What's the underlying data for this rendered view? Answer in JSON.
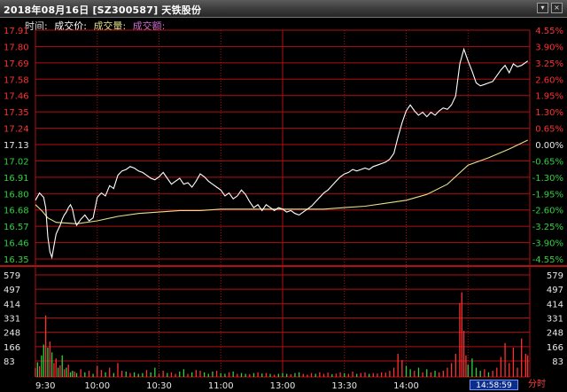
{
  "window": {
    "title": "2018年08月16日 [SZ300587] 天铁股份",
    "buttons": [
      "▾",
      "×"
    ]
  },
  "legend": {
    "items": [
      "时间",
      "成交价",
      "成交量",
      "成交额"
    ],
    "separator": ":"
  },
  "colors": {
    "grid": "#b01010",
    "price_line": "#ffffff",
    "avg_line": "#e6e08c",
    "volume_up": "#ff3030",
    "volume_down": "#30d040",
    "axis_up": "#ff3030",
    "axis_flat": "#e8e8e8",
    "axis_down": "#30d040",
    "volume_axis": "#e8e8e8"
  },
  "status": {
    "current_time": "14:58:59",
    "mode": "分时"
  },
  "chart_data": {
    "type": "line",
    "price_axis_left": [
      "17.91",
      "17.80",
      "17.69",
      "17.58",
      "17.46",
      "17.35",
      "17.24",
      "17.13",
      "17.02",
      "16.91",
      "16.80",
      "16.68",
      "16.57",
      "16.46",
      "16.35"
    ],
    "price_axis_right": [
      "4.55%",
      "3.90%",
      "3.25%",
      "2.60%",
      "1.95%",
      "1.30%",
      "0.65%",
      "0.00%",
      "-0.65%",
      "-1.30%",
      "-1.95%",
      "-2.60%",
      "-3.25%",
      "-3.90%",
      "-4.55%"
    ],
    "volume_axis": [
      "579",
      "497",
      "414",
      "331",
      "248",
      "166",
      "83"
    ],
    "x_labels": [
      "9:30",
      "10:00",
      "10:30",
      "11:00",
      "13:00",
      "13:30",
      "14:00"
    ],
    "price_range": [
      16.35,
      17.91
    ],
    "volume_range": [
      0,
      663
    ],
    "minutes_total": 240,
    "series": [
      {
        "values": [
          [
            0,
            16.75
          ],
          [
            2,
            16.8
          ],
          [
            4,
            16.77
          ],
          [
            5,
            16.7
          ],
          [
            6,
            16.5
          ],
          [
            7,
            16.4
          ],
          [
            8,
            16.36
          ],
          [
            9,
            16.44
          ],
          [
            10,
            16.52
          ],
          [
            11,
            16.55
          ],
          [
            12,
            16.58
          ],
          [
            13,
            16.62
          ],
          [
            14,
            16.65
          ],
          [
            15,
            16.67
          ],
          [
            16,
            16.7
          ],
          [
            17,
            16.72
          ],
          [
            18,
            16.69
          ],
          [
            19,
            16.62
          ],
          [
            20,
            16.58
          ],
          [
            22,
            16.62
          ],
          [
            24,
            16.65
          ],
          [
            26,
            16.61
          ],
          [
            28,
            16.63
          ],
          [
            30,
            16.77
          ],
          [
            32,
            16.8
          ],
          [
            34,
            16.78
          ],
          [
            36,
            16.85
          ],
          [
            38,
            16.83
          ],
          [
            40,
            16.92
          ],
          [
            42,
            16.95
          ],
          [
            44,
            16.96
          ],
          [
            46,
            16.98
          ],
          [
            48,
            16.97
          ],
          [
            50,
            16.95
          ],
          [
            52,
            16.94
          ],
          [
            54,
            16.92
          ],
          [
            56,
            16.9
          ],
          [
            58,
            16.89
          ],
          [
            60,
            16.91
          ],
          [
            62,
            16.94
          ],
          [
            64,
            16.9
          ],
          [
            66,
            16.86
          ],
          [
            68,
            16.88
          ],
          [
            70,
            16.9
          ],
          [
            72,
            16.86
          ],
          [
            74,
            16.87
          ],
          [
            76,
            16.84
          ],
          [
            78,
            16.88
          ],
          [
            80,
            16.93
          ],
          [
            82,
            16.91
          ],
          [
            84,
            16.88
          ],
          [
            86,
            16.86
          ],
          [
            88,
            16.84
          ],
          [
            90,
            16.82
          ],
          [
            92,
            16.78
          ],
          [
            94,
            16.8
          ],
          [
            96,
            16.76
          ],
          [
            98,
            16.78
          ],
          [
            100,
            16.82
          ],
          [
            102,
            16.79
          ],
          [
            104,
            16.74
          ],
          [
            106,
            16.7
          ],
          [
            108,
            16.72
          ],
          [
            110,
            16.68
          ],
          [
            112,
            16.72
          ],
          [
            114,
            16.7
          ],
          [
            116,
            16.68
          ],
          [
            118,
            16.7
          ],
          [
            120,
            16.69
          ],
          [
            122,
            16.67
          ],
          [
            124,
            16.68
          ],
          [
            126,
            16.66
          ],
          [
            128,
            16.65
          ],
          [
            130,
            16.67
          ],
          [
            132,
            16.69
          ],
          [
            134,
            16.71
          ],
          [
            136,
            16.74
          ],
          [
            138,
            16.77
          ],
          [
            140,
            16.8
          ],
          [
            142,
            16.82
          ],
          [
            144,
            16.85
          ],
          [
            146,
            16.88
          ],
          [
            148,
            16.91
          ],
          [
            150,
            16.93
          ],
          [
            152,
            16.94
          ],
          [
            154,
            16.96
          ],
          [
            156,
            16.95
          ],
          [
            158,
            16.96
          ],
          [
            160,
            16.97
          ],
          [
            162,
            16.96
          ],
          [
            164,
            16.98
          ],
          [
            166,
            16.99
          ],
          [
            168,
            17.0
          ],
          [
            170,
            17.01
          ],
          [
            172,
            17.03
          ],
          [
            174,
            17.07
          ],
          [
            176,
            17.18
          ],
          [
            178,
            17.28
          ],
          [
            180,
            17.36
          ],
          [
            182,
            17.4
          ],
          [
            184,
            17.36
          ],
          [
            186,
            17.33
          ],
          [
            188,
            17.35
          ],
          [
            190,
            17.32
          ],
          [
            192,
            17.35
          ],
          [
            194,
            17.33
          ],
          [
            196,
            17.36
          ],
          [
            198,
            17.38
          ],
          [
            200,
            17.37
          ],
          [
            202,
            17.4
          ],
          [
            204,
            17.46
          ],
          [
            206,
            17.68
          ],
          [
            208,
            17.78
          ],
          [
            210,
            17.7
          ],
          [
            212,
            17.63
          ],
          [
            214,
            17.55
          ],
          [
            216,
            17.53
          ],
          [
            218,
            17.54
          ],
          [
            220,
            17.55
          ],
          [
            222,
            17.56
          ],
          [
            224,
            17.6
          ],
          [
            226,
            17.64
          ],
          [
            228,
            17.67
          ],
          [
            230,
            17.62
          ],
          [
            232,
            17.68
          ],
          [
            234,
            17.66
          ],
          [
            236,
            17.67
          ],
          [
            238,
            17.69
          ],
          [
            239,
            17.7
          ]
        ]
      },
      {
        "values": [
          [
            0,
            16.72
          ],
          [
            3,
            16.68
          ],
          [
            6,
            16.63
          ],
          [
            10,
            16.6
          ],
          [
            20,
            16.59
          ],
          [
            30,
            16.61
          ],
          [
            40,
            16.64
          ],
          [
            50,
            16.66
          ],
          [
            60,
            16.67
          ],
          [
            70,
            16.68
          ],
          [
            80,
            16.68
          ],
          [
            90,
            16.69
          ],
          [
            100,
            16.69
          ],
          [
            110,
            16.69
          ],
          [
            120,
            16.69
          ],
          [
            130,
            16.69
          ],
          [
            140,
            16.69
          ],
          [
            150,
            16.7
          ],
          [
            160,
            16.71
          ],
          [
            170,
            16.73
          ],
          [
            180,
            16.75
          ],
          [
            190,
            16.79
          ],
          [
            200,
            16.86
          ],
          [
            210,
            16.99
          ],
          [
            220,
            17.04
          ],
          [
            230,
            17.1
          ],
          [
            239,
            17.16
          ]
        ]
      }
    ],
    "volume_bars": [
      [
        0,
        58,
        "u"
      ],
      [
        1,
        95,
        "d"
      ],
      [
        2,
        70,
        "u"
      ],
      [
        3,
        140,
        "d"
      ],
      [
        4,
        210,
        "d"
      ],
      [
        5,
        400,
        "u"
      ],
      [
        6,
        190,
        "d"
      ],
      [
        7,
        230,
        "u"
      ],
      [
        8,
        160,
        "d"
      ],
      [
        9,
        90,
        "u"
      ],
      [
        10,
        120,
        "u"
      ],
      [
        11,
        60,
        "d"
      ],
      [
        12,
        75,
        "u"
      ],
      [
        13,
        140,
        "d"
      ],
      [
        14,
        50,
        "u"
      ],
      [
        15,
        60,
        "d"
      ],
      [
        16,
        80,
        "u"
      ],
      [
        17,
        30,
        "d"
      ],
      [
        18,
        40,
        "d"
      ],
      [
        19,
        35,
        "u"
      ],
      [
        20,
        25,
        "d"
      ],
      [
        22,
        50,
        "u"
      ],
      [
        24,
        30,
        "d"
      ],
      [
        26,
        40,
        "u"
      ],
      [
        28,
        20,
        "d"
      ],
      [
        30,
        70,
        "u"
      ],
      [
        32,
        45,
        "u"
      ],
      [
        34,
        30,
        "d"
      ],
      [
        36,
        60,
        "u"
      ],
      [
        38,
        25,
        "d"
      ],
      [
        40,
        90,
        "u"
      ],
      [
        42,
        40,
        "u"
      ],
      [
        44,
        35,
        "d"
      ],
      [
        46,
        25,
        "u"
      ],
      [
        48,
        30,
        "d"
      ],
      [
        50,
        20,
        "d"
      ],
      [
        52,
        25,
        "d"
      ],
      [
        54,
        45,
        "u"
      ],
      [
        56,
        30,
        "d"
      ],
      [
        58,
        60,
        "d"
      ],
      [
        60,
        20,
        "u"
      ],
      [
        62,
        40,
        "u"
      ],
      [
        64,
        25,
        "d"
      ],
      [
        66,
        30,
        "u"
      ],
      [
        68,
        20,
        "u"
      ],
      [
        70,
        35,
        "d"
      ],
      [
        72,
        50,
        "d"
      ],
      [
        74,
        20,
        "u"
      ],
      [
        76,
        30,
        "d"
      ],
      [
        78,
        45,
        "u"
      ],
      [
        80,
        40,
        "u"
      ],
      [
        82,
        30,
        "d"
      ],
      [
        84,
        20,
        "d"
      ],
      [
        86,
        35,
        "d"
      ],
      [
        88,
        40,
        "u"
      ],
      [
        90,
        25,
        "d"
      ],
      [
        92,
        20,
        "d"
      ],
      [
        94,
        30,
        "u"
      ],
      [
        96,
        35,
        "d"
      ],
      [
        98,
        20,
        "u"
      ],
      [
        100,
        25,
        "d"
      ],
      [
        102,
        20,
        "d"
      ],
      [
        104,
        18,
        "u"
      ],
      [
        106,
        25,
        "d"
      ],
      [
        108,
        30,
        "u"
      ],
      [
        110,
        22,
        "d"
      ],
      [
        112,
        25,
        "u"
      ],
      [
        114,
        20,
        "d"
      ],
      [
        116,
        15,
        "u"
      ],
      [
        118,
        20,
        "d"
      ],
      [
        120,
        25,
        "d"
      ],
      [
        122,
        20,
        "d"
      ],
      [
        124,
        18,
        "u"
      ],
      [
        126,
        25,
        "d"
      ],
      [
        128,
        30,
        "d"
      ],
      [
        130,
        20,
        "u"
      ],
      [
        132,
        15,
        "u"
      ],
      [
        134,
        25,
        "u"
      ],
      [
        136,
        20,
        "d"
      ],
      [
        138,
        30,
        "u"
      ],
      [
        140,
        20,
        "u"
      ],
      [
        142,
        28,
        "u"
      ],
      [
        144,
        18,
        "d"
      ],
      [
        146,
        22,
        "u"
      ],
      [
        148,
        30,
        "u"
      ],
      [
        150,
        25,
        "d"
      ],
      [
        152,
        20,
        "u"
      ],
      [
        154,
        35,
        "u"
      ],
      [
        156,
        20,
        "d"
      ],
      [
        158,
        25,
        "u"
      ],
      [
        160,
        30,
        "u"
      ],
      [
        162,
        20,
        "d"
      ],
      [
        164,
        25,
        "u"
      ],
      [
        166,
        22,
        "u"
      ],
      [
        168,
        30,
        "u"
      ],
      [
        170,
        28,
        "u"
      ],
      [
        172,
        40,
        "u"
      ],
      [
        174,
        60,
        "u"
      ],
      [
        176,
        150,
        "u"
      ],
      [
        178,
        110,
        "u"
      ],
      [
        180,
        70,
        "d"
      ],
      [
        182,
        50,
        "d"
      ],
      [
        184,
        40,
        "u"
      ],
      [
        186,
        60,
        "d"
      ],
      [
        188,
        30,
        "u"
      ],
      [
        190,
        50,
        "d"
      ],
      [
        192,
        30,
        "u"
      ],
      [
        194,
        40,
        "d"
      ],
      [
        196,
        30,
        "u"
      ],
      [
        198,
        40,
        "u"
      ],
      [
        200,
        60,
        "u"
      ],
      [
        202,
        90,
        "u"
      ],
      [
        204,
        150,
        "u"
      ],
      [
        206,
        480,
        "u"
      ],
      [
        207,
        550,
        "u"
      ],
      [
        208,
        300,
        "u"
      ],
      [
        209,
        140,
        "u"
      ],
      [
        210,
        80,
        "d"
      ],
      [
        212,
        120,
        "d"
      ],
      [
        214,
        60,
        "d"
      ],
      [
        216,
        40,
        "d"
      ],
      [
        218,
        50,
        "u"
      ],
      [
        220,
        30,
        "d"
      ],
      [
        222,
        40,
        "u"
      ],
      [
        224,
        60,
        "u"
      ],
      [
        226,
        130,
        "u"
      ],
      [
        228,
        220,
        "u"
      ],
      [
        230,
        90,
        "u"
      ],
      [
        232,
        190,
        "u"
      ],
      [
        234,
        60,
        "u"
      ],
      [
        236,
        250,
        "u"
      ],
      [
        238,
        150,
        "u"
      ],
      [
        239,
        140,
        "u"
      ]
    ]
  }
}
